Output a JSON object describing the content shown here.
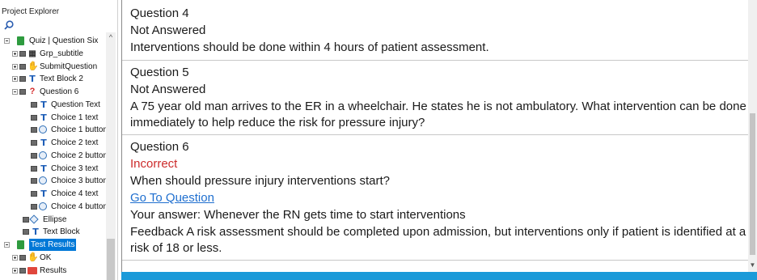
{
  "explorer": {
    "title": "Project Explorer",
    "tree": [
      {
        "label": "Quiz | Question Six",
        "icon": "page-icon",
        "indent": 0,
        "expander": "minus",
        "eye": false
      },
      {
        "label": "Grp_subtitle",
        "icon": "group-icon",
        "indent": 1,
        "expander": "plus",
        "eye": true
      },
      {
        "label": "SubmitQuestion",
        "icon": "button-icon",
        "indent": 1,
        "expander": "plus",
        "eye": true
      },
      {
        "label": "Text Block 2",
        "icon": "text-icon",
        "indent": 1,
        "expander": "plus",
        "eye": true
      },
      {
        "label": "Question 6",
        "icon": "question-icon",
        "indent": 1,
        "expander": "minus",
        "eye": true
      },
      {
        "label": "Question Text",
        "icon": "text-icon",
        "indent": 2,
        "expander": null,
        "eye": true
      },
      {
        "label": "Choice 1 text",
        "icon": "text-icon",
        "indent": 2,
        "expander": null,
        "eye": true
      },
      {
        "label": "Choice 1 button",
        "icon": "radio-icon",
        "indent": 2,
        "expander": null,
        "eye": true
      },
      {
        "label": "Choice 2 text",
        "icon": "text-icon",
        "indent": 2,
        "expander": null,
        "eye": true
      },
      {
        "label": "Choice 2 button",
        "icon": "radio-icon",
        "indent": 2,
        "expander": null,
        "eye": true
      },
      {
        "label": "Choice 3 text",
        "icon": "text-icon",
        "indent": 2,
        "expander": null,
        "eye": true
      },
      {
        "label": "Choice 3 button",
        "icon": "radio-icon",
        "indent": 2,
        "expander": null,
        "eye": true
      },
      {
        "label": "Choice 4 text",
        "icon": "text-icon",
        "indent": 2,
        "expander": null,
        "eye": true
      },
      {
        "label": "Choice 4 button",
        "icon": "radio-icon",
        "indent": 2,
        "expander": null,
        "eye": true
      },
      {
        "label": "Ellipse",
        "icon": "diamond-icon",
        "indent": 1,
        "expander": null,
        "eye": true
      },
      {
        "label": "Text Block",
        "icon": "text-icon",
        "indent": 1,
        "expander": null,
        "eye": true
      },
      {
        "label": "Test Results",
        "icon": "page-icon",
        "indent": 0,
        "expander": "minus",
        "eye": false,
        "selected": true
      },
      {
        "label": "OK",
        "icon": "button-icon",
        "indent": 1,
        "expander": "plus",
        "eye": true
      },
      {
        "label": "Results",
        "icon": "results-icon",
        "indent": 1,
        "expander": "plus",
        "eye": true
      }
    ]
  },
  "questions": [
    {
      "title": "Question 4",
      "status": "Not Answered",
      "status_type": "neutral",
      "text": "Interventions should be done within 4 hours of patient assessment."
    },
    {
      "title": "Question 5",
      "status": "Not Answered",
      "status_type": "neutral",
      "text": "A 75 year old man arrives to the ER in a wheelchair. He states he is not ambulatory. What intervention can be done immediately to help reduce the risk for pressure injury?"
    },
    {
      "title": "Question 6",
      "status": "Incorrect",
      "status_type": "incorrect",
      "text": "When should pressure injury interventions start?",
      "link": "Go To Question",
      "answer": "Your answer: Whenever the RN gets time to start interventions",
      "feedback": "Feedback A risk assessment should be completed upon admission, but interventions only if patient is identified at a risk of 18 or less."
    }
  ],
  "colors": {
    "incorrect": "#cc2b2b",
    "link": "#1f6fcf",
    "selection": "#0078d7",
    "bottom_bar": "#1a9ad9"
  }
}
